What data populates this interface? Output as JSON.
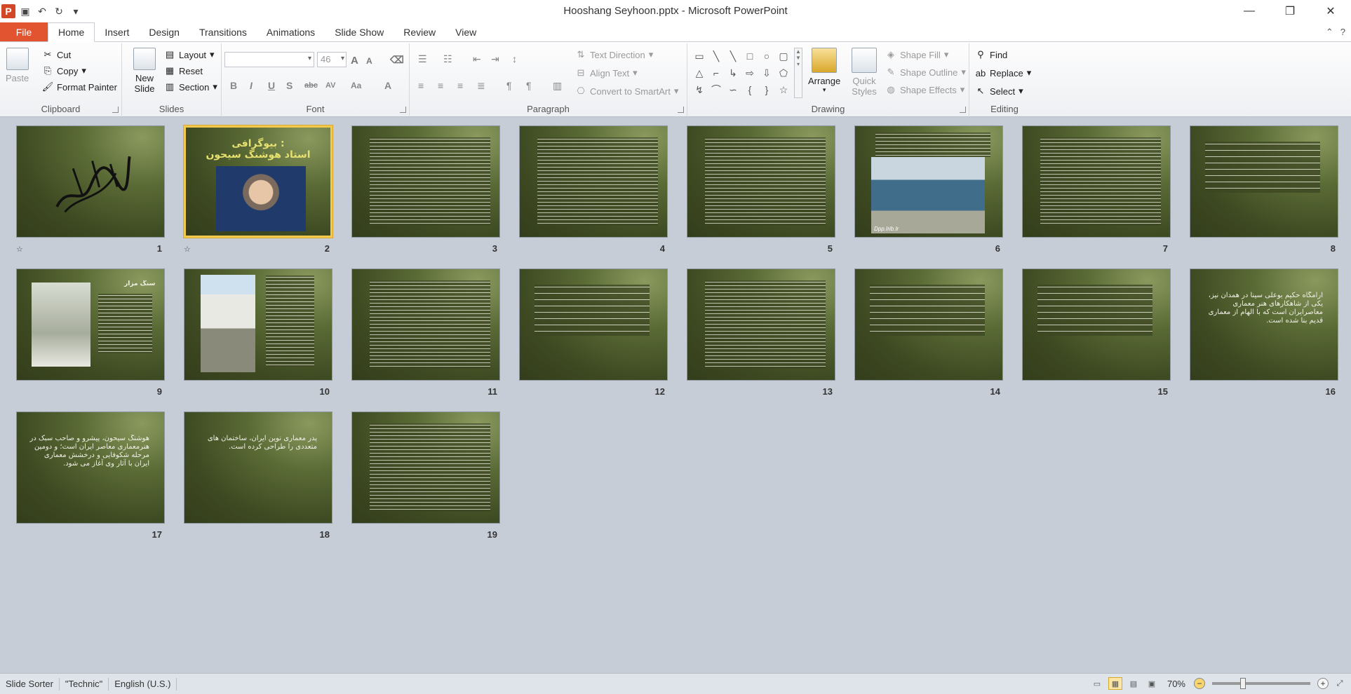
{
  "window": {
    "title": "Hooshang Seyhoon.pptx  -  Microsoft PowerPoint",
    "qat_icons": [
      "powerpoint-logo",
      "save-icon",
      "undo-icon",
      "redo-icon",
      "customize-icon"
    ],
    "controls": {
      "minimize": "—",
      "restore": "❐",
      "close": "✕"
    }
  },
  "tabs": [
    {
      "label": "File"
    },
    {
      "label": "Home"
    },
    {
      "label": "Insert"
    },
    {
      "label": "Design"
    },
    {
      "label": "Transitions"
    },
    {
      "label": "Animations"
    },
    {
      "label": "Slide Show"
    },
    {
      "label": "Review"
    },
    {
      "label": "View"
    }
  ],
  "ribbon": {
    "clipboard": {
      "label": "Clipboard",
      "paste": "Paste",
      "cut": "Cut",
      "copy": "Copy",
      "format_painter": "Format Painter"
    },
    "slides": {
      "label": "Slides",
      "new_slide": "New Slide",
      "layout": "Layout",
      "reset": "Reset",
      "section": "Section"
    },
    "font": {
      "label": "Font",
      "font_name": "",
      "font_size": "46",
      "bold": "B",
      "italic": "I",
      "underline": "U",
      "shadow": "S",
      "strike": "abc",
      "spacing": "AV",
      "case": "Aa",
      "color": "A",
      "grow": "A",
      "shrink": "A"
    },
    "paragraph": {
      "label": "Paragraph",
      "text_direction": "Text Direction",
      "align_text": "Align Text",
      "convert_smartart": "Convert to SmartArt"
    },
    "drawing": {
      "label": "Drawing",
      "arrange": "Arrange",
      "quick_styles": "Quick Styles",
      "shape_fill": "Shape Fill",
      "shape_outline": "Shape Outline",
      "shape_effects": "Shape Effects"
    },
    "editing": {
      "label": "Editing",
      "find": "Find",
      "replace": "Replace",
      "select": "Select"
    }
  },
  "slides": [
    {
      "num": "1",
      "kind": "calligraphy",
      "has_anim": true
    },
    {
      "num": "2",
      "kind": "title-photo",
      "title_line1": "بیوگرافی :",
      "title_line2": "استاد هوشنگ سیحون",
      "has_anim": true,
      "selected": true
    },
    {
      "num": "3",
      "kind": "dense-text"
    },
    {
      "num": "4",
      "kind": "dense-text"
    },
    {
      "num": "5",
      "kind": "dense-text"
    },
    {
      "num": "6",
      "kind": "photo-bottom",
      "caption": "Dpp.Irib.Ir"
    },
    {
      "num": "7",
      "kind": "dense-text"
    },
    {
      "num": "8",
      "kind": "sparse-text"
    },
    {
      "num": "9",
      "kind": "photo-left",
      "heading": "سنگ مزار"
    },
    {
      "num": "10",
      "kind": "photo-left-tall"
    },
    {
      "num": "11",
      "kind": "dense-text"
    },
    {
      "num": "12",
      "kind": "sparse-text"
    },
    {
      "num": "13",
      "kind": "dense-text"
    },
    {
      "num": "14",
      "kind": "sparse-text"
    },
    {
      "num": "15",
      "kind": "sparse-text"
    },
    {
      "num": "16",
      "kind": "sparse-text",
      "text": "آرامگاه حکیم بوعلی سینا در همدان نیز، یکی از شاهکارهای هنر معماری معاصرایران است که با الهام از معماری قدیم بنا شده است."
    },
    {
      "num": "17",
      "kind": "sparse-text",
      "text": "هوشنگ سیحون، پیشرو و صاحب سبک در هنرمعماری معاصر ایران است؛ و دومین مرحله شکوفایی و درخشش معماری ایران با آثار وی آغاز می شود."
    },
    {
      "num": "18",
      "kind": "sparse-text",
      "text": "پدر معماری نوین ایران، ساختمان های متعددی را طراحی کرده است."
    },
    {
      "num": "19",
      "kind": "dense-text"
    }
  ],
  "status": {
    "view": "Slide Sorter",
    "theme": "\"Technic\"",
    "language": "English (U.S.)",
    "zoom": "70%",
    "zoom_fraction": 0.3
  }
}
